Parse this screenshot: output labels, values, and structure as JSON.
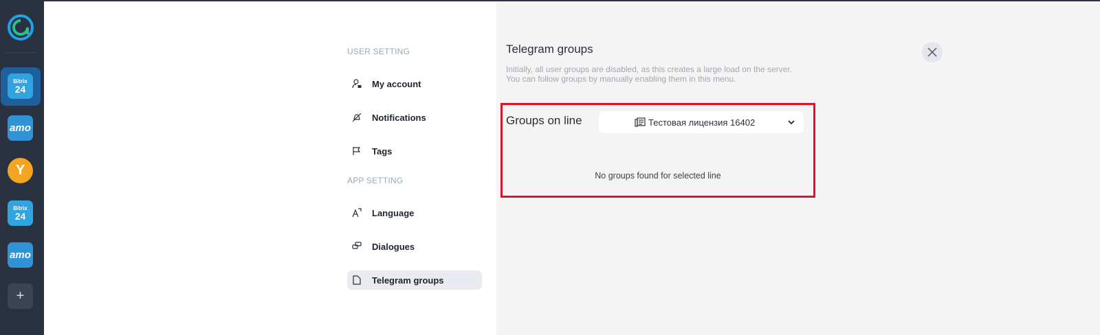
{
  "rail": {
    "apps": [
      {
        "kind": "bitrix",
        "top": "Bitrix",
        "bottom": "24",
        "active": true
      },
      {
        "kind": "amo",
        "label": "amo"
      },
      {
        "kind": "ya",
        "label": "Y"
      },
      {
        "kind": "bitrix",
        "top": "Bitrix",
        "bottom": "24"
      },
      {
        "kind": "amo",
        "label": "amo"
      }
    ],
    "add_label": "+"
  },
  "menu": {
    "user_section": "USER SETTING",
    "app_section": "APP SETTING",
    "items": [
      {
        "label": "My account",
        "icon": "user-lock-icon"
      },
      {
        "label": "Notifications",
        "icon": "bell-off-icon"
      },
      {
        "label": "Tags",
        "icon": "flag-icon"
      },
      {
        "label": "Language",
        "icon": "translate-icon"
      },
      {
        "label": "Dialogues",
        "icon": "chat-bubbles-icon"
      },
      {
        "label": "Telegram groups",
        "icon": "document-icon",
        "active": true
      }
    ]
  },
  "panel": {
    "title": "Telegram groups",
    "description": "Initially, all user groups are disabled, as this creates a large load on the server. You can follow groups by manually enabling them in this menu.",
    "lines_label": "Groups on line",
    "selected_line": "Тестовая лицензия 16402",
    "empty_message": "No groups found for selected line"
  },
  "colors": {
    "rail_bg": "#2a3141",
    "panel_bg": "#f4f4f4",
    "highlight": "#e0112b",
    "accent": "#1e5f9e"
  }
}
